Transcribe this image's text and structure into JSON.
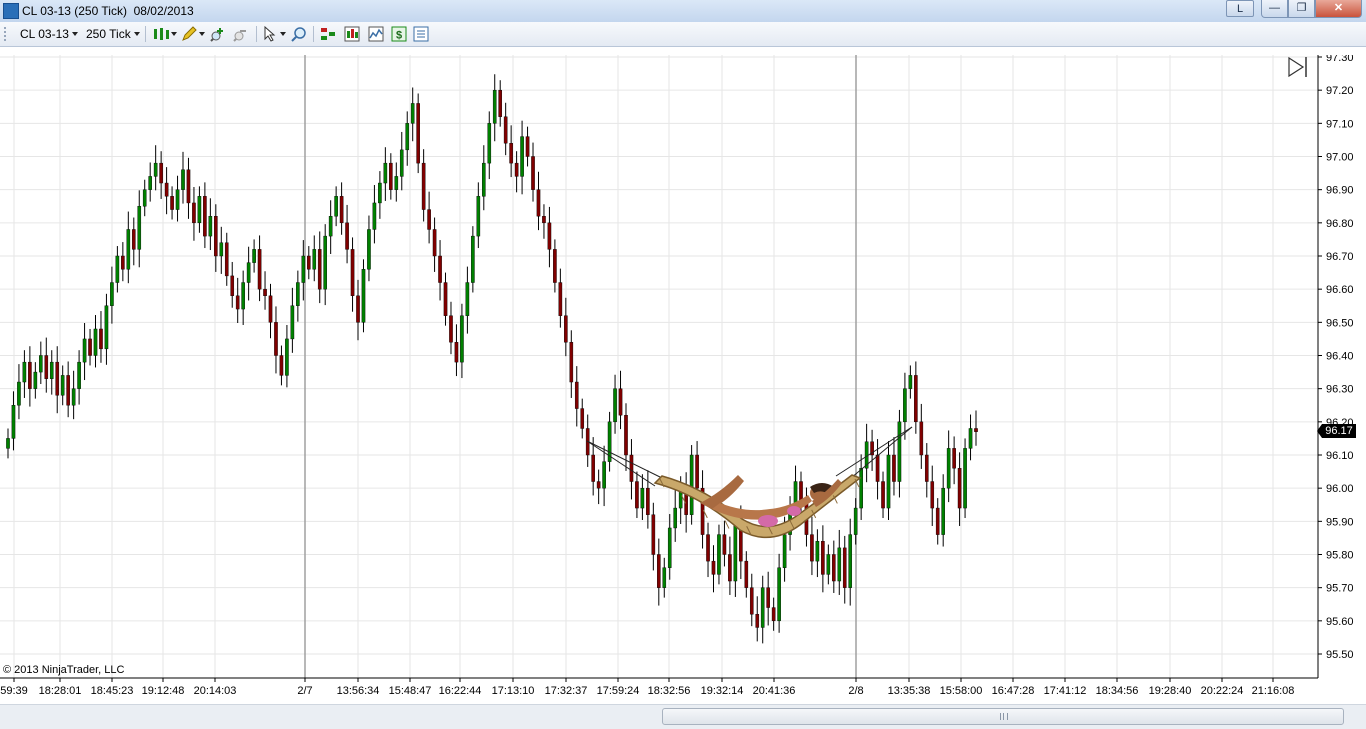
{
  "window": {
    "title": "CL 03-13 (250 Tick)  08/02/2013",
    "l_button": "L",
    "min_glyph": "—",
    "max_glyph": "❐",
    "close_glyph": "✕"
  },
  "toolbar": {
    "instrument": "CL 03-13",
    "interval": "250 Tick",
    "icons": [
      "bar-style-icon",
      "pencil-drawing-icon",
      "zoom-in-icon",
      "zoom-out-icon",
      "cursor-pointer-icon",
      "magnify-icon",
      "data-box-icon",
      "chart-style-icon",
      "indicators-icon",
      "strategy-dollar-icon",
      "properties-icon"
    ]
  },
  "chart": {
    "copyright": "© 2013 NinjaTrader, LLC",
    "current_price": "96.17",
    "colors": {
      "up_bar": "#008000",
      "down_bar": "#800000",
      "wick": "#000000",
      "grid": "#e6e6e6",
      "session_line": "#a0a0a0"
    }
  },
  "chart_data": {
    "type": "bar",
    "title": "",
    "xlabel": "",
    "ylabel": "",
    "ylim": [
      95.45,
      97.31
    ],
    "y_ticks": [
      "97.30",
      "97.20",
      "97.10",
      "97.00",
      "96.90",
      "96.80",
      "96.70",
      "96.60",
      "96.50",
      "96.40",
      "96.30",
      "96.20",
      "96.10",
      "96.00",
      "95.90",
      "95.80",
      "95.70",
      "95.60",
      "95.50"
    ],
    "x_tick_labels": [
      "59:39",
      "18:28:01",
      "18:45:23",
      "19:12:48",
      "20:14:03",
      "2/7",
      "13:56:34",
      "15:48:47",
      "16:22:44",
      "17:13:10",
      "17:32:37",
      "17:59:24",
      "18:32:56",
      "19:32:14",
      "20:41:36",
      "2/8",
      "13:35:38",
      "15:58:00",
      "16:47:28",
      "17:41:12",
      "18:34:56",
      "19:28:40",
      "20:22:24",
      "21:16:08"
    ],
    "series": [
      {
        "values": [
          96.15,
          96.25,
          96.32,
          96.38,
          96.3,
          96.35,
          96.4,
          96.33,
          96.38,
          96.28,
          96.34,
          96.25,
          96.3,
          96.38,
          96.45,
          96.4,
          96.48,
          96.42,
          96.55,
          96.62,
          96.7,
          96.66,
          96.78,
          96.72,
          96.85,
          96.9,
          96.94,
          96.98,
          96.92,
          96.88,
          96.84,
          96.9,
          96.96,
          96.86,
          96.8,
          96.88,
          96.76,
          96.82,
          96.7,
          96.74,
          96.64,
          96.58,
          96.54,
          96.62,
          96.68,
          96.72,
          96.6,
          96.58,
          96.5,
          96.4,
          96.34,
          96.45,
          96.55,
          96.62,
          96.7,
          96.66,
          96.72,
          96.6,
          96.76,
          96.82,
          96.88,
          96.8,
          96.72,
          96.58,
          96.5,
          96.66,
          96.78,
          96.86,
          96.92,
          96.98,
          96.9,
          96.94,
          97.02,
          97.1,
          97.16,
          96.98,
          96.84,
          96.78,
          96.7,
          96.62,
          96.52,
          96.44,
          96.38,
          96.52,
          96.62,
          96.76,
          96.88,
          96.98,
          97.1,
          97.2,
          97.12,
          97.04,
          96.98,
          96.94,
          97.06,
          97.0,
          96.9,
          96.82,
          96.8,
          96.72,
          96.62,
          96.52,
          96.44,
          96.32,
          96.24,
          96.18,
          96.1,
          96.02,
          96.0,
          96.08,
          96.2,
          96.3,
          96.22,
          96.1,
          96.02,
          95.94,
          96.0,
          95.92,
          95.8,
          95.7,
          95.76,
          95.88,
          95.94,
          96.0,
          95.92,
          96.1,
          96.0,
          95.86,
          95.78,
          95.74,
          95.86,
          95.8,
          95.72,
          95.9,
          95.78,
          95.7,
          95.62,
          95.58,
          95.7,
          95.64,
          95.6,
          95.76,
          95.86,
          95.94,
          96.02,
          95.96,
          95.86,
          95.78,
          95.84,
          95.74,
          95.8,
          95.72,
          95.82,
          95.7,
          95.86,
          95.94,
          96.06,
          96.14,
          96.1,
          96.02,
          95.94,
          96.1,
          96.02,
          96.2,
          96.3,
          96.34,
          96.2,
          96.1,
          96.02,
          95.94,
          95.86,
          96.0,
          96.12,
          96.06,
          95.94,
          96.12,
          96.18,
          96.17
        ]
      }
    ]
  }
}
